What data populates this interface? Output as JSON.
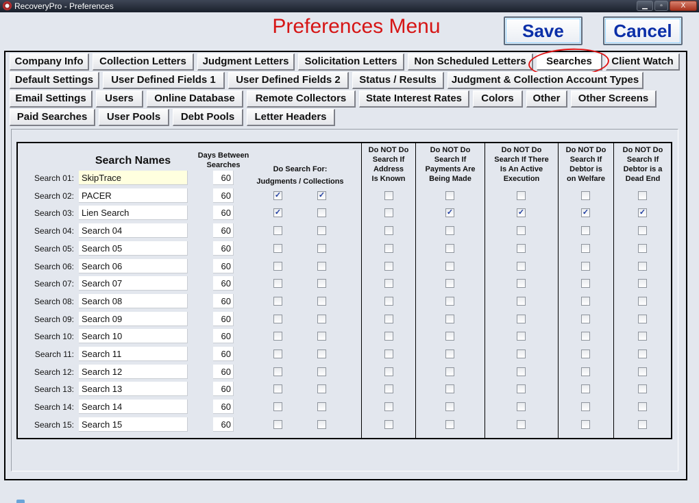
{
  "window": {
    "title": "RecoveryPro - Preferences",
    "controls": [
      "▁",
      "▫",
      "X"
    ]
  },
  "header": {
    "title": "Preferences Menu",
    "save_label": "Save",
    "cancel_label": "Cancel"
  },
  "tabs": [
    [
      {
        "label": "Company Info",
        "active": false
      },
      {
        "label": "Collection Letters",
        "active": false
      },
      {
        "label": "Judgment Letters",
        "active": false
      },
      {
        "label": "Solicitation Letters",
        "active": false
      },
      {
        "label": "Non Scheduled Letters",
        "active": false
      },
      {
        "label": "Searches",
        "active": true
      },
      {
        "label": "Client Watch",
        "active": false
      }
    ],
    [
      {
        "label": "Default Settings",
        "active": false
      },
      {
        "label": "User Defined Fields 1",
        "active": false
      },
      {
        "label": "User Defined Fields 2",
        "active": false
      },
      {
        "label": "Status / Results",
        "active": false
      },
      {
        "label": "Judgment & Collection Account Types",
        "active": false
      }
    ],
    [
      {
        "label": "Email Settings",
        "active": false
      },
      {
        "label": "Users",
        "active": false
      },
      {
        "label": "Online Database",
        "active": false
      },
      {
        "label": "Remote Collectors",
        "active": false
      },
      {
        "label": "State Interest Rates",
        "active": false
      },
      {
        "label": "Colors",
        "active": false
      },
      {
        "label": "Other",
        "active": false
      },
      {
        "label": "Other Screens",
        "active": false
      }
    ],
    [
      {
        "label": "Paid Searches",
        "active": false
      },
      {
        "label": "User Pools",
        "active": false
      },
      {
        "label": "Debt Pools",
        "active": false
      },
      {
        "label": "Letter Headers",
        "active": false
      }
    ]
  ],
  "grid": {
    "headers": {
      "search_names": "Search Names",
      "days_between_1": "Days Between",
      "days_between_2": "Searches",
      "do_search_for": "Do Search For:",
      "judgments_collections": "Judgments / Collections",
      "address_known": [
        "Do NOT Do",
        "Search If",
        "Address",
        "Is Known"
      ],
      "payments_made": [
        "Do NOT Do",
        "Search If",
        "Payments Are",
        "Being Made"
      ],
      "active_execution": [
        "Do NOT Do",
        "Search If There",
        "Is An Active",
        "Execution"
      ],
      "on_welfare": [
        "Do NOT Do",
        "Search If",
        "Debtor is",
        "on Welfare"
      ],
      "dead_end": [
        "Do NOT Do",
        "Search If",
        "Debtor is a",
        "Dead End"
      ]
    },
    "rows": [
      {
        "label": "Search 01:",
        "name": "SkipTrace",
        "days": "60",
        "checks": [
          false,
          false,
          false,
          false,
          false,
          false,
          false
        ]
      },
      {
        "label": "Search 02:",
        "name": "PACER",
        "days": "60",
        "checks": [
          true,
          true,
          false,
          false,
          false,
          false,
          false
        ]
      },
      {
        "label": "Search 03:",
        "name": "Lien Search",
        "days": "60",
        "checks": [
          true,
          false,
          false,
          true,
          true,
          true,
          true
        ]
      },
      {
        "label": "Search 04:",
        "name": "Search 04",
        "days": "60",
        "checks": [
          false,
          false,
          false,
          false,
          false,
          false,
          false
        ]
      },
      {
        "label": "Search 05:",
        "name": "Search 05",
        "days": "60",
        "checks": [
          false,
          false,
          false,
          false,
          false,
          false,
          false
        ]
      },
      {
        "label": "Search 06:",
        "name": "Search 06",
        "days": "60",
        "checks": [
          false,
          false,
          false,
          false,
          false,
          false,
          false
        ]
      },
      {
        "label": "Search 07:",
        "name": "Search 07",
        "days": "60",
        "checks": [
          false,
          false,
          false,
          false,
          false,
          false,
          false
        ]
      },
      {
        "label": "Search 08:",
        "name": "Search 08",
        "days": "60",
        "checks": [
          false,
          false,
          false,
          false,
          false,
          false,
          false
        ]
      },
      {
        "label": "Search 09:",
        "name": "Search 09",
        "days": "60",
        "checks": [
          false,
          false,
          false,
          false,
          false,
          false,
          false
        ]
      },
      {
        "label": "Search 10:",
        "name": "Search 10",
        "days": "60",
        "checks": [
          false,
          false,
          false,
          false,
          false,
          false,
          false
        ]
      },
      {
        "label": "Search 11:",
        "name": "Search 11",
        "days": "60",
        "checks": [
          false,
          false,
          false,
          false,
          false,
          false,
          false
        ]
      },
      {
        "label": "Search 12:",
        "name": "Search 12",
        "days": "60",
        "checks": [
          false,
          false,
          false,
          false,
          false,
          false,
          false
        ]
      },
      {
        "label": "Search 13:",
        "name": "Search 13",
        "days": "60",
        "checks": [
          false,
          false,
          false,
          false,
          false,
          false,
          false
        ]
      },
      {
        "label": "Search 14:",
        "name": "Search 14",
        "days": "60",
        "checks": [
          false,
          false,
          false,
          false,
          false,
          false,
          false
        ]
      },
      {
        "label": "Search 15:",
        "name": "Search 15",
        "days": "60",
        "checks": [
          false,
          false,
          false,
          false,
          false,
          false,
          false
        ]
      }
    ]
  },
  "colors": {
    "title_red": "#d61515",
    "button_blue": "#0b2fa8",
    "highlight_circle": "#e01414",
    "background": "#e3e7ee"
  }
}
